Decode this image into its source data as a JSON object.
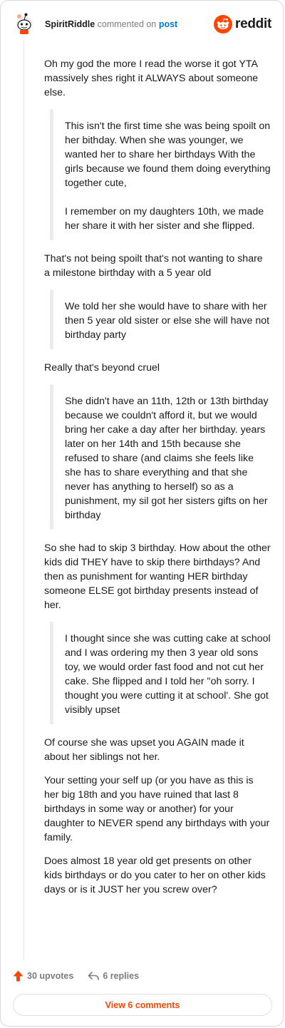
{
  "header": {
    "username": "SpiritRiddle",
    "action": "commented on",
    "post_link": "post",
    "brand": "reddit"
  },
  "comment": {
    "blocks": [
      {
        "type": "p",
        "text": "Oh my god the more I read the worse it got YTA massively shes right it ALWAYS about someone else."
      },
      {
        "type": "quote",
        "paras": [
          "This isn't the first time she was being spoilt on her bithday. When she was younger, we wanted her to share her birthdays With the girls because we found them doing everything together cute,",
          "I remember on my daughters 10th, we made her share it with her sister and she flipped."
        ]
      },
      {
        "type": "p",
        "text": "That's not being spoilt that's not wanting to share a milestone birthday with a 5 year old"
      },
      {
        "type": "quote",
        "paras": [
          "We told her she would have to share with her then 5 year old sister or else she will have not birthday party"
        ]
      },
      {
        "type": "p",
        "text": "Really that's beyond cruel"
      },
      {
        "type": "quote",
        "paras": [
          "She didn't have an 11th, 12th or 13th birthday because we couldn't afford it, but we would bring her cake a day after her birthday. years later on her 14th and 15th because she refused to share (and claims she feels like she has to share everything and that she never has anything to herself) so as a punishment, my sil got her sisters gifts on her birthday"
        ]
      },
      {
        "type": "p",
        "text": "So she had to skip 3 birthday. How about the other kids did THEY have to skip there birthdays? And then as punishment for wanting HER birthday someone ELSE got birthday presents instead of her."
      },
      {
        "type": "quote",
        "paras": [
          "I thought since she was cutting cake at school and I was ordering my then 3 year old sons toy, we would order fast food and not cut her cake. She flipped and I told her \"oh sorry. I thought you were cutting it at school'. She got visibly upset"
        ]
      },
      {
        "type": "p",
        "text": "Of course she was upset you AGAIN made it about her siblings not her."
      },
      {
        "type": "p",
        "text": "Your setting your self up (or you have as this is her big 18th and you have ruined that last 8 birthdays in some way or another) for your daughter to NEVER spend any birthdays with your family."
      },
      {
        "type": "p",
        "text": "Does almost 18 year old get presents on other kids birthdays or do you cater to her on other kids days or is it JUST her you screw over?"
      }
    ]
  },
  "footer": {
    "upvotes": "30 upvotes",
    "replies": "6 replies",
    "view_button": "View 6 comments"
  },
  "colors": {
    "accent": "#ff4500",
    "link": "#0079d3",
    "muted": "#7c7c7c"
  },
  "icons": [
    "avatar-icon",
    "reddit-logo-icon",
    "upvote-arrow-icon",
    "reply-arrow-icon"
  ]
}
